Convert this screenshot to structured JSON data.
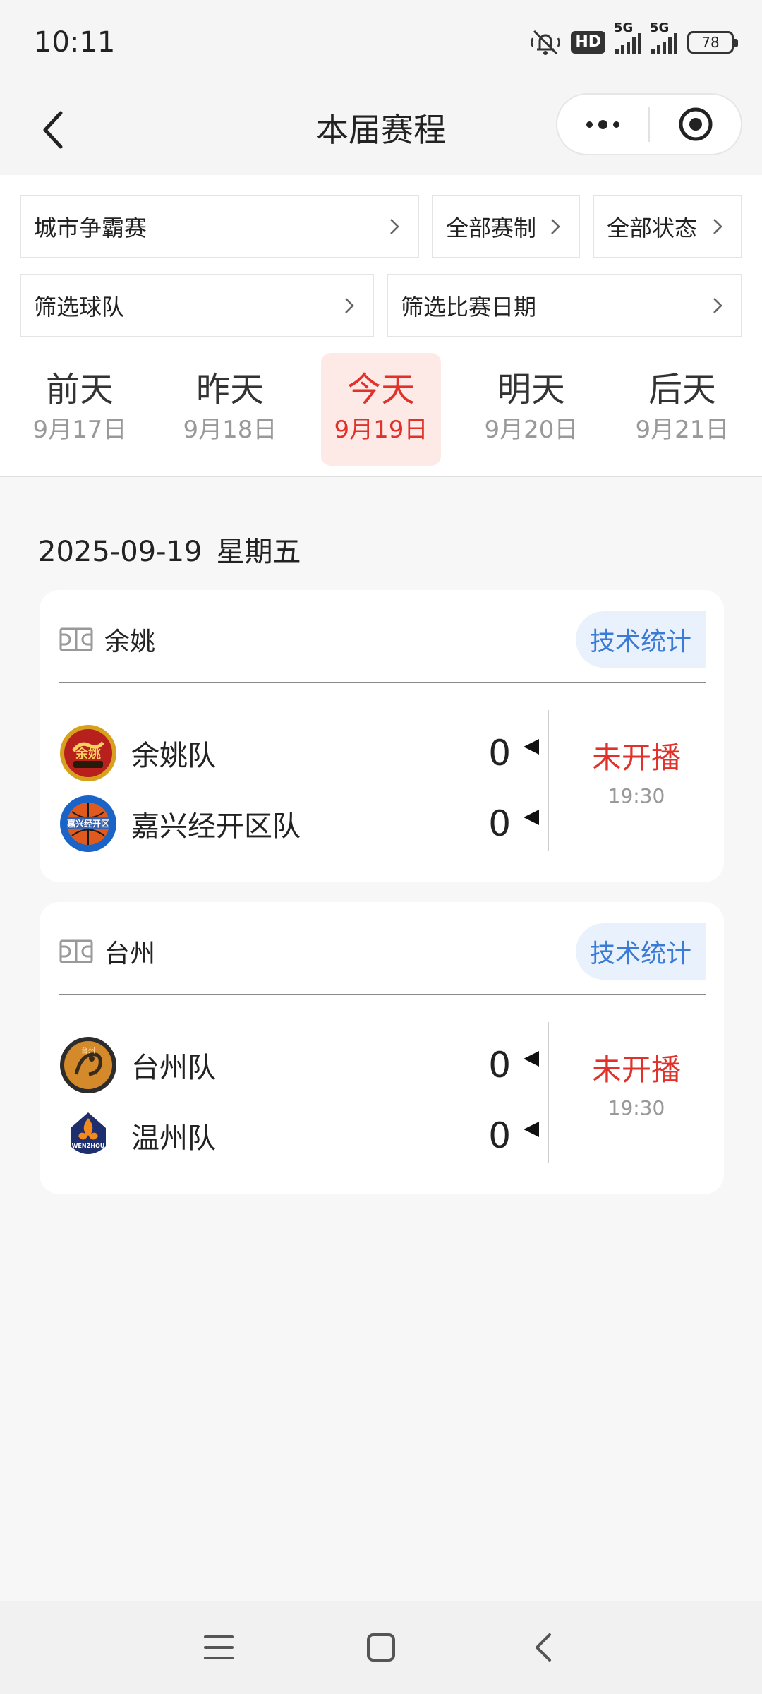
{
  "status_bar": {
    "time": "10:11",
    "hd_label": "HD",
    "network_1": "5G",
    "network_2": "5G",
    "battery": "78"
  },
  "nav": {
    "title": "本届赛程"
  },
  "filters": {
    "competition": "城市争霸赛",
    "format": "全部赛制",
    "status": "全部状态",
    "team": "筛选球队",
    "date": "筛选比赛日期"
  },
  "date_tabs": [
    {
      "day": "前天",
      "date": "9月17日"
    },
    {
      "day": "昨天",
      "date": "9月18日"
    },
    {
      "day": "今天",
      "date": "9月19日",
      "active": true
    },
    {
      "day": "明天",
      "date": "9月20日"
    },
    {
      "day": "后天",
      "date": "9月21日"
    }
  ],
  "selected_day": {
    "date": "2025-09-19",
    "weekday": "星期五"
  },
  "matches": [
    {
      "venue": "余姚",
      "stats_label": "技术统计",
      "home": {
        "name": "余姚队",
        "score": "0",
        "logo_text": "余姚"
      },
      "away": {
        "name": "嘉兴经开区队",
        "score": "0",
        "logo_text": "嘉兴经开区"
      },
      "status": "未开播",
      "time": "19:30"
    },
    {
      "venue": "台州",
      "stats_label": "技术统计",
      "home": {
        "name": "台州队",
        "score": "0",
        "logo_text": "台州"
      },
      "away": {
        "name": "温州队",
        "score": "0",
        "logo_text": "WENZHOU"
      },
      "status": "未开播",
      "time": "19:30"
    }
  ],
  "colors": {
    "accent_red": "#e0322a",
    "active_tab_bg": "#fde9e6",
    "stats_blue": "#3a7bd5",
    "stats_bg": "#e9f1fc"
  }
}
